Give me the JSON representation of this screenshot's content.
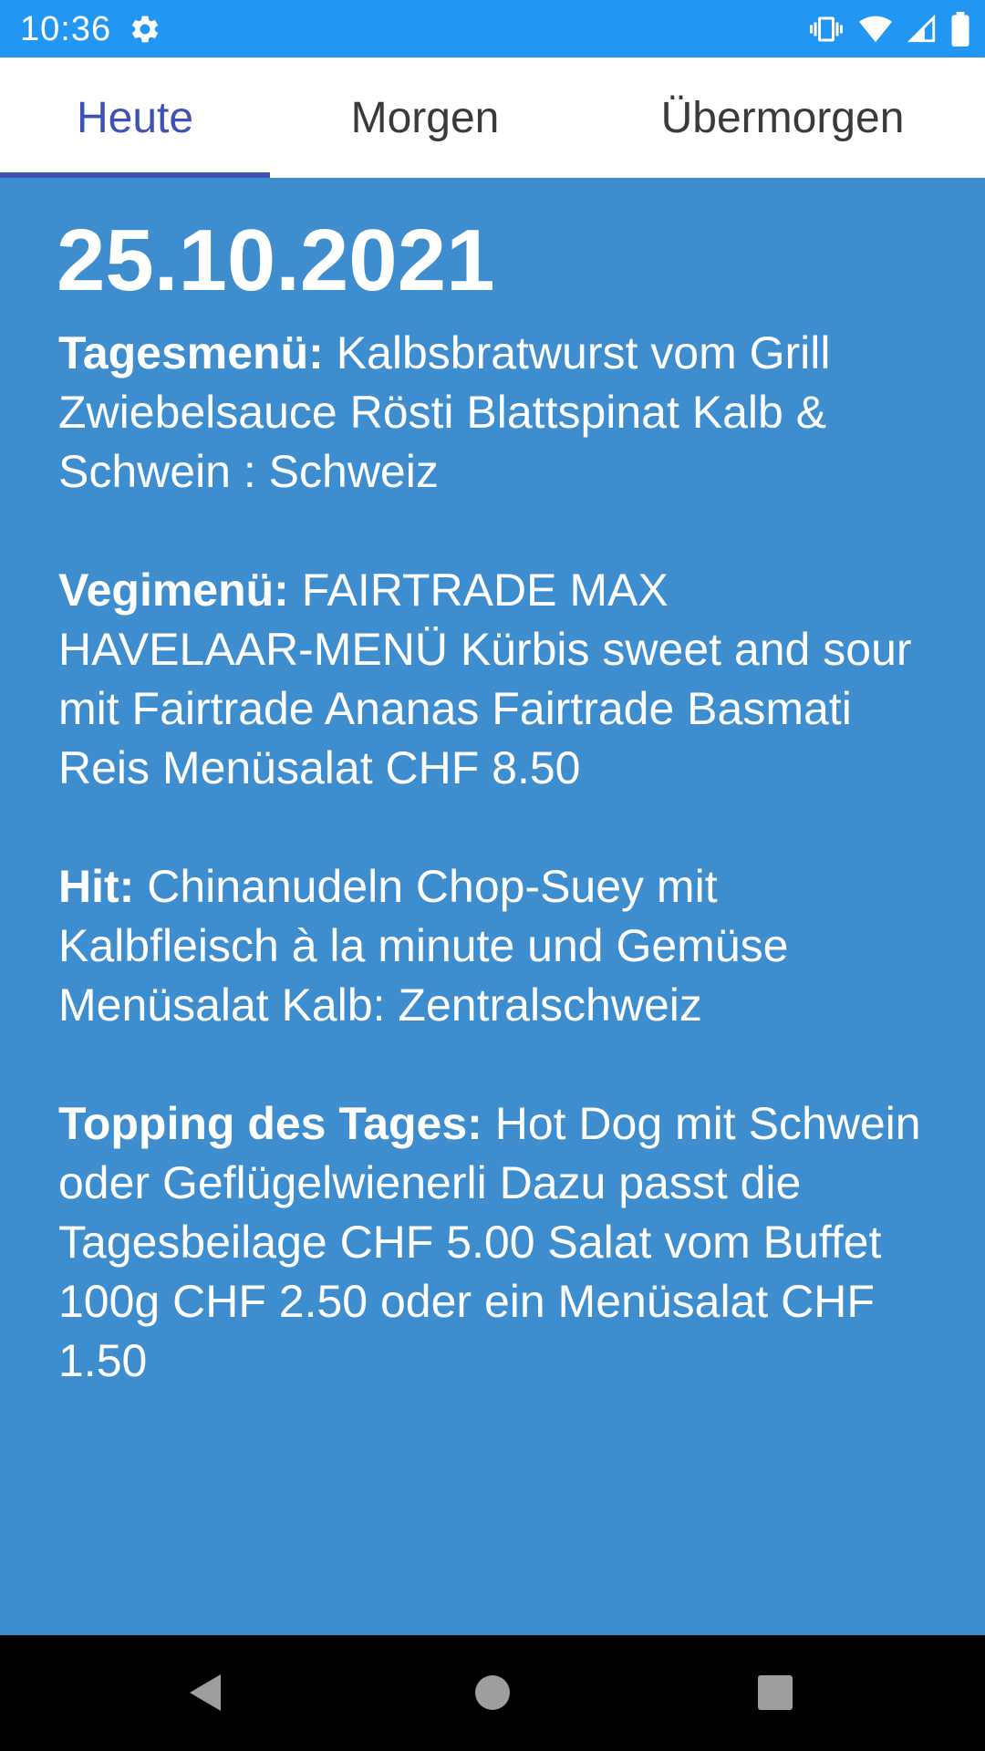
{
  "status_bar": {
    "time": "10:36",
    "background_color": "#2196f3",
    "icons": [
      "settings-gear-icon",
      "vibrate-icon",
      "wifi-icon",
      "signal-icon",
      "battery-icon"
    ]
  },
  "tabs": [
    {
      "label": "Heute",
      "active": true
    },
    {
      "label": "Morgen",
      "active": false
    },
    {
      "label": "Übermorgen",
      "active": false
    }
  ],
  "colors": {
    "accent": "#3f51b5",
    "content_background": "#3e8ecf",
    "text": "#ffffff"
  },
  "content": {
    "date": "25.10.2021",
    "menus": [
      {
        "label": "Tagesmenü:",
        "text": "Kalbsbratwurst vom Grill Zwiebelsauce Rösti Blattspinat Kalb & Schwein : Schweiz"
      },
      {
        "label": "Vegimenü:",
        "text": "FAIRTRADE MAX HAVELAAR-MENÜ Kürbis sweet and sour mit Fairtrade Ananas Fairtrade Basmati Reis Menüsalat CHF 8.50"
      },
      {
        "label": "Hit:",
        "text": "Chinanudeln Chop-Suey mit Kalbfleisch à la minute und Gemüse Menüsalat Kalb: Zentralschweiz"
      },
      {
        "label": "Topping des Tages:",
        "text": "Hot Dog mit Schwein oder Geflügelwienerli Dazu passt die Tagesbeilage CHF 5.00 Salat vom Buffet 100g CHF 2.50 oder ein Menüsalat CHF 1.50"
      }
    ]
  },
  "nav_bar": {
    "buttons": [
      "back-icon",
      "home-icon",
      "recents-icon"
    ]
  }
}
